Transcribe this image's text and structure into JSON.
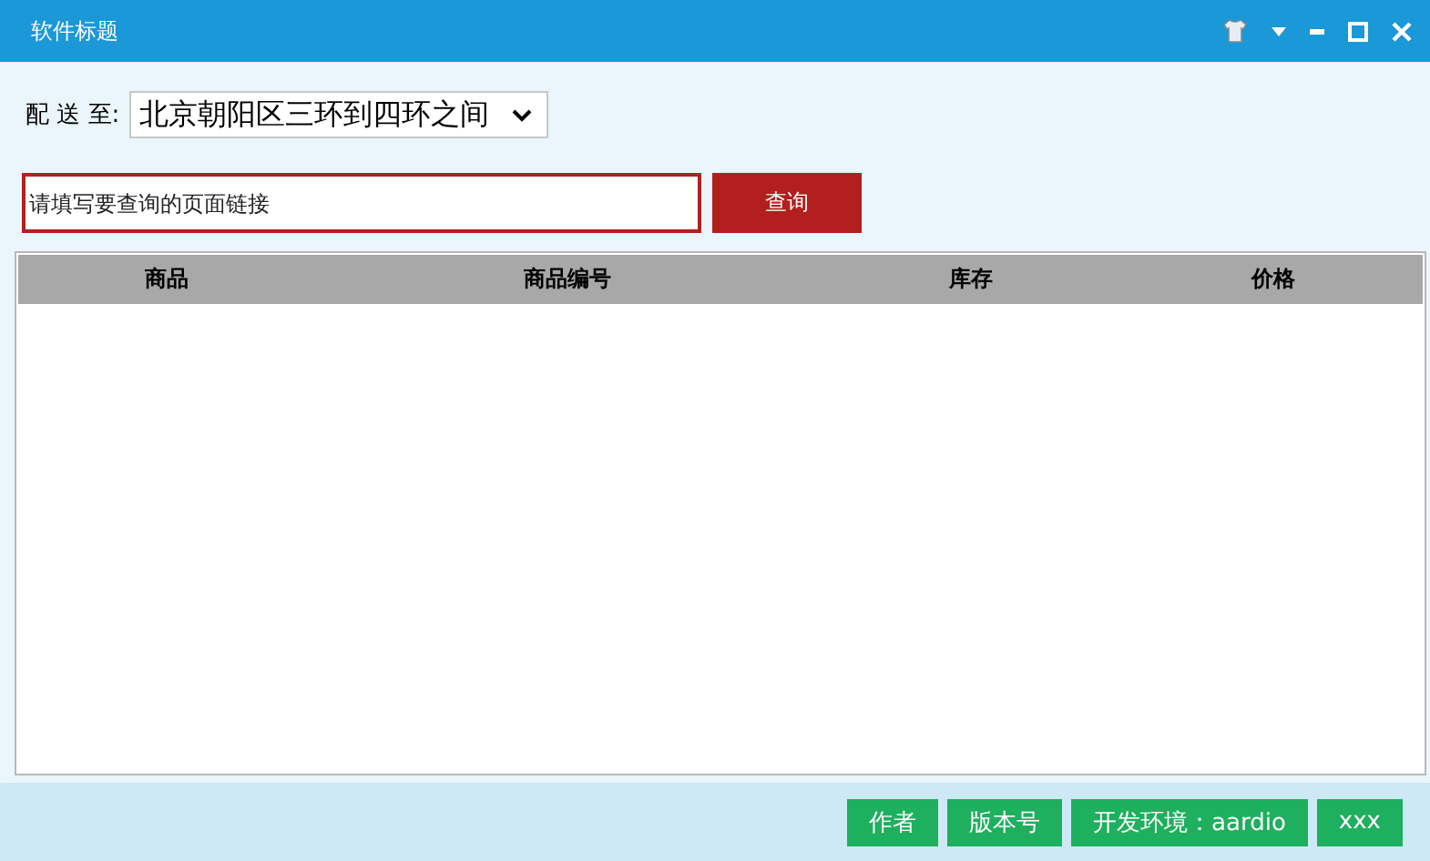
{
  "window": {
    "title": "软件标题"
  },
  "delivery": {
    "label": "配 送 至:",
    "value": "北京朝阳区三环到四环之间"
  },
  "search": {
    "placeholder": "请填写要查询的页面链接",
    "button": "查询"
  },
  "table": {
    "columns": [
      "商品",
      "商品编号",
      "库存",
      "价格"
    ]
  },
  "footer_buttons": [
    "作者",
    "版本号",
    "开发环境：aardio",
    "xxx"
  ]
}
